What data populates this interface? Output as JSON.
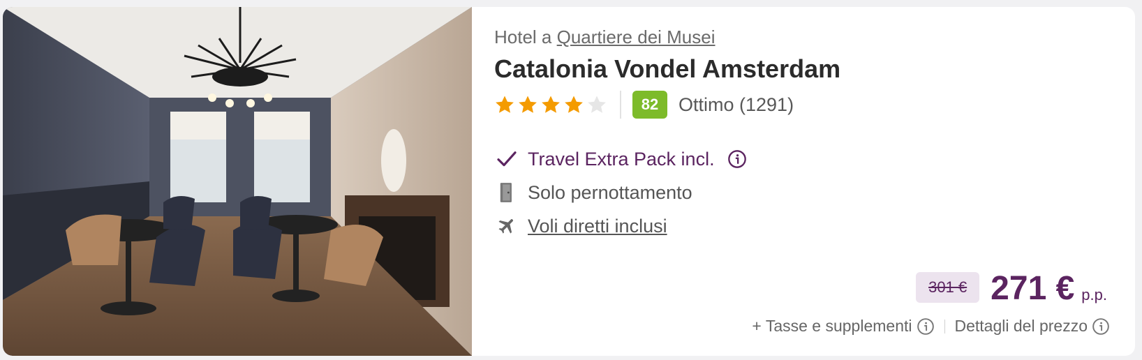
{
  "hotel": {
    "location_prefix": "Hotel a",
    "location_link": "Quartiere dei Musei",
    "name": "Catalonia Vondel Amsterdam",
    "stars": 4,
    "max_stars": 5,
    "score": "82",
    "score_label": "Ottimo (1291)"
  },
  "features": [
    {
      "icon": "check-icon",
      "label": "Travel Extra Pack incl."
    },
    {
      "icon": "door-icon",
      "label": "Solo pernottamento"
    },
    {
      "icon": "plane-icon",
      "label": "Voli diretti inclusi"
    }
  ],
  "price": {
    "old": "301 €",
    "current": "271 €",
    "unit": "p.p."
  },
  "footer": {
    "taxes_label": "+ Tasse e supplementi",
    "details_label": "Dettagli del prezzo"
  },
  "colors": {
    "accent": "#5b2460",
    "star": "#f49b00",
    "star_empty": "#e6e6e6",
    "score_badge": "#7dbb2a"
  }
}
